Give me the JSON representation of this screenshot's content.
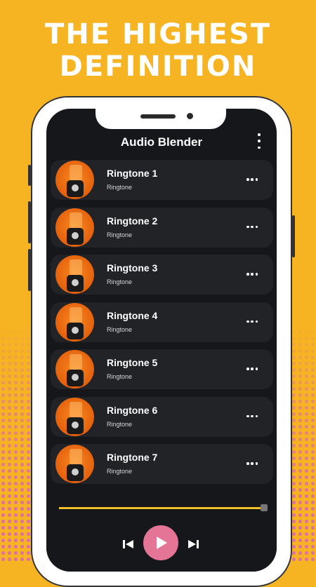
{
  "headline": {
    "line1": "THE HIGHEST",
    "line2": "DEFINITION"
  },
  "app": {
    "title": "Audio Blender",
    "menu_icon": "kebab-menu-icon"
  },
  "ringtones": [
    {
      "title": "Ringtone 1",
      "subtitle": "Ringtone"
    },
    {
      "title": "Ringtone 2",
      "subtitle": "Ringtone"
    },
    {
      "title": "Ringtone 3",
      "subtitle": "Ringtone"
    },
    {
      "title": "Ringtone 4",
      "subtitle": "Ringtone"
    },
    {
      "title": "Ringtone 5",
      "subtitle": "Ringtone"
    },
    {
      "title": "Ringtone 6",
      "subtitle": "Ringtone"
    },
    {
      "title": "Ringtone 7",
      "subtitle": "Ringtone"
    }
  ],
  "player": {
    "progress": 1.0
  },
  "colors": {
    "background": "#F6B422",
    "dots": "#E0719A",
    "screen": "#16171A",
    "row": "#222327",
    "play_button": "#E47596",
    "progress_track": "#F2C12A"
  }
}
